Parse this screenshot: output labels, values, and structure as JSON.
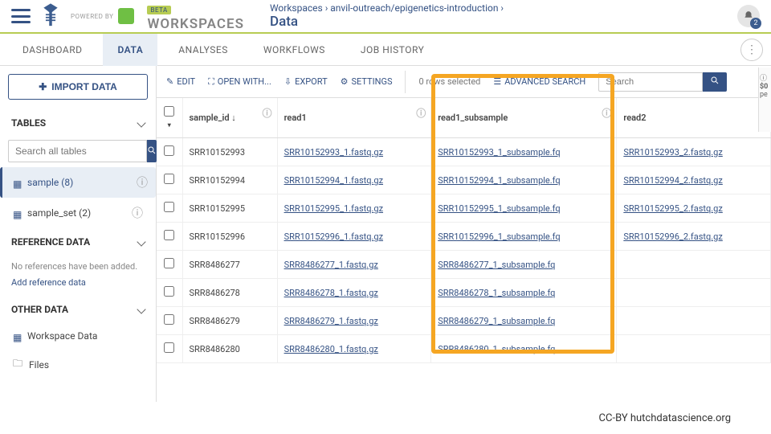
{
  "header": {
    "powered": "POWERED BY",
    "beta": "BETA",
    "workspaces": "WORKSPACES",
    "breadcrumb": "Workspaces ›  anvil-outreach/epigenetics-introduction  ›",
    "page": "Data",
    "notif_count": "2"
  },
  "tabs": [
    "DASHBOARD",
    "DATA",
    "ANALYSES",
    "WORKFLOWS",
    "JOB HISTORY"
  ],
  "sidebar": {
    "import": "IMPORT DATA",
    "tables": "TABLES",
    "search_ph": "Search all tables",
    "items": [
      {
        "label": "sample  (8)"
      },
      {
        "label": "sample_set  (2)"
      }
    ],
    "refdata": "REFERENCE DATA",
    "ref_note": "No references have been added.",
    "ref_link": "Add reference data",
    "other": "OTHER DATA",
    "other_items": [
      {
        "label": "Workspace Data"
      },
      {
        "label": "Files"
      }
    ]
  },
  "toolbar": {
    "edit": "EDIT",
    "open": "OPEN WITH...",
    "export": "EXPORT",
    "settings": "SETTINGS",
    "rows": "0 rows selected",
    "adv": "ADVANCED SEARCH",
    "search_ph": "Search"
  },
  "columns": [
    "sample_id",
    "read1",
    "read1_subsample",
    "read2"
  ],
  "rows": [
    {
      "id": "SRR10152993",
      "r1": "SRR10152993_1.fastq.gz",
      "sub": "SRR10152993_1_subsample.fq",
      "r2": "SRR10152993_2.fastq.gz"
    },
    {
      "id": "SRR10152994",
      "r1": "SRR10152994_1.fastq.gz",
      "sub": "SRR10152994_1_subsample.fq",
      "r2": "SRR10152994_2.fastq.gz"
    },
    {
      "id": "SRR10152995",
      "r1": "SRR10152995_1.fastq.gz",
      "sub": "SRR10152995_1_subsample.fq",
      "r2": "SRR10152995_2.fastq.gz"
    },
    {
      "id": "SRR10152996",
      "r1": "SRR10152996_1.fastq.gz",
      "sub": "SRR10152996_1_subsample.fq",
      "r2": "SRR10152996_2.fastq.gz"
    },
    {
      "id": "SRR8486277",
      "r1": "SRR8486277_1.fastq.gz",
      "sub": "SRR8486277_1_subsample.fq",
      "r2": ""
    },
    {
      "id": "SRR8486278",
      "r1": "SRR8486278_1.fastq.gz",
      "sub": "SRR8486278_1_subsample.fq",
      "r2": ""
    },
    {
      "id": "SRR8486279",
      "r1": "SRR8486279_1.fastq.gz",
      "sub": "SRR8486279_1_subsample.fq",
      "r2": ""
    },
    {
      "id": "SRR8486280",
      "r1": "SRR8486280_1.fastq.gz",
      "sub": "SRR8486280_1_subsample.fq",
      "r2": ""
    }
  ],
  "side_panel": {
    "cost": "$0",
    "label": "pe"
  },
  "footer": "CC-BY  hutchdatascience.org"
}
